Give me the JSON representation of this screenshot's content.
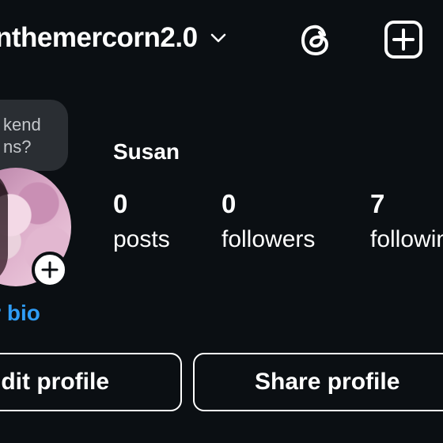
{
  "header": {
    "username": "nthemercorn2.0",
    "username_dropdown_icon": "chevron-down-icon",
    "threads_icon": "threads-icon",
    "create_icon": "plus-square-icon"
  },
  "note": {
    "line1": "kend",
    "line2": "ns?"
  },
  "profile": {
    "display_name": "Susan",
    "avatar_add_icon": "plus-icon"
  },
  "stats": {
    "posts": {
      "value": "0",
      "label": "posts"
    },
    "followers": {
      "value": "0",
      "label": "followers"
    },
    "following": {
      "value": "7",
      "label": "following"
    }
  },
  "bio": {
    "link_label": "our bio"
  },
  "actions": {
    "edit_label": "dit profile",
    "share_label": "Share profile"
  },
  "colors": {
    "background": "#0b0f13",
    "text": "#ffffff",
    "link": "#2f9cf6",
    "bubble": "#2a2e33"
  }
}
